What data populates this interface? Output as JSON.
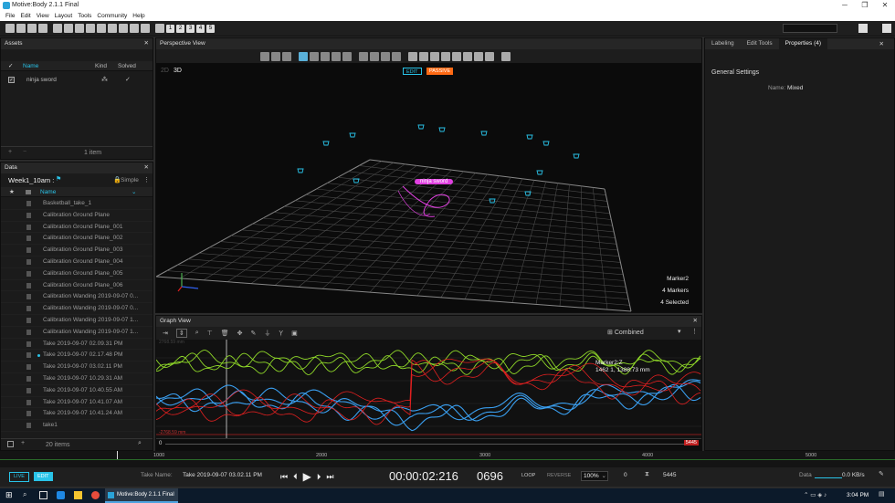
{
  "window": {
    "title": "Motive:Body 2.1.1 Final"
  },
  "menu": [
    "File",
    "Edit",
    "View",
    "Layout",
    "Tools",
    "Community",
    "Help"
  ],
  "toolbar": {
    "numbers": [
      "1",
      "2",
      "3",
      "4",
      "5"
    ]
  },
  "assets": {
    "title": "Assets",
    "columns": {
      "name": "Name",
      "kind": "Kind",
      "solved": "Solved"
    },
    "rows": [
      {
        "name": "ninja sword"
      }
    ],
    "footer": "1 item"
  },
  "data_panel": {
    "title": "Data",
    "session": "Week1_10am :",
    "mode": "Simple",
    "column_name": "Name",
    "rows": [
      {
        "name": "Basketball_take_1",
        "dot": false
      },
      {
        "name": "Calibration Ground Plane",
        "dot": false
      },
      {
        "name": "Calibration Ground Plane_001",
        "dot": false
      },
      {
        "name": "Calibration Ground Plane_002",
        "dot": false
      },
      {
        "name": "Calibration Ground Plane_003",
        "dot": false
      },
      {
        "name": "Calibration Ground Plane_004",
        "dot": false
      },
      {
        "name": "Calibration Ground Plane_005",
        "dot": false
      },
      {
        "name": "Calibration Ground Plane_006",
        "dot": false
      },
      {
        "name": "Calibration Wanding 2019-09-07 0...",
        "dot": false
      },
      {
        "name": "Calibration Wanding 2019-09-07 0...",
        "dot": false
      },
      {
        "name": "Calibration Wanding 2019-09-07 1...",
        "dot": false
      },
      {
        "name": "Calibration Wanding 2019-09-07 1...",
        "dot": false
      },
      {
        "name": "Take 2019-09-07 02.09.31 PM",
        "dot": false
      },
      {
        "name": "Take 2019-09-07 02.17.48 PM",
        "dot": true
      },
      {
        "name": "Take 2019-09-07 03.02.11 PM",
        "dot": false
      },
      {
        "name": "Take 2019-09-07 10.29.31 AM",
        "dot": false
      },
      {
        "name": "Take 2019-09-07 10.40.55 AM",
        "dot": false
      },
      {
        "name": "Take 2019-09-07 10.41.07 AM",
        "dot": false
      },
      {
        "name": "Take 2019-09-07 10.41.24 AM",
        "dot": false
      },
      {
        "name": "take1",
        "dot": false
      }
    ],
    "footer": "20 items"
  },
  "perspective": {
    "title": "Perspective View",
    "mode_2d": "2D",
    "mode_3d": "3D",
    "edit_badge": "EDIT",
    "passive_badge": "PASSIVE",
    "asset_label": "ninja sword",
    "info": [
      "Marker2",
      "4 Markers",
      "4 Selected"
    ]
  },
  "graph": {
    "title": "Graph View",
    "layout": "Combined",
    "marker_label": "Marker2:Z",
    "marker_value": "1462 1, 1388.73 mm",
    "top_value": "2768.59 mm",
    "bottom_value": "-2768.59 mm",
    "range_start": "0",
    "range_end": "5445"
  },
  "properties": {
    "tabs": [
      "Labeling",
      "Edit Tools",
      "Properties (4)"
    ],
    "section": "General Settings",
    "name_label": "Name:",
    "name_value": "Mixed"
  },
  "timeline": {
    "ticks": [
      "1000",
      "2000",
      "3000",
      "4000",
      "5000"
    ]
  },
  "transport": {
    "live": "LIVE",
    "edit": "EDIT",
    "take_label": "Take Name:",
    "take_name": "Take 2019-09-07 03.02.11 PM",
    "timecode": "00:00:02:216",
    "frame": "0696",
    "loop": "LOOP",
    "reverse": "REVERSE",
    "speed": "100%",
    "start_frame": "0",
    "end_frame": "5445",
    "data_label": "Data",
    "rate": "0.0 KB/s"
  },
  "taskbar": {
    "app_label": "Motive:Body 2.1.1 Final",
    "time": "3:04 PM"
  },
  "colors": {
    "accent": "#29c3e8",
    "passive": "#ff6a14",
    "asset": "#e040e0",
    "graph_x": "#e02020",
    "graph_y": "#8ed628",
    "graph_z": "#3a9ff0"
  }
}
